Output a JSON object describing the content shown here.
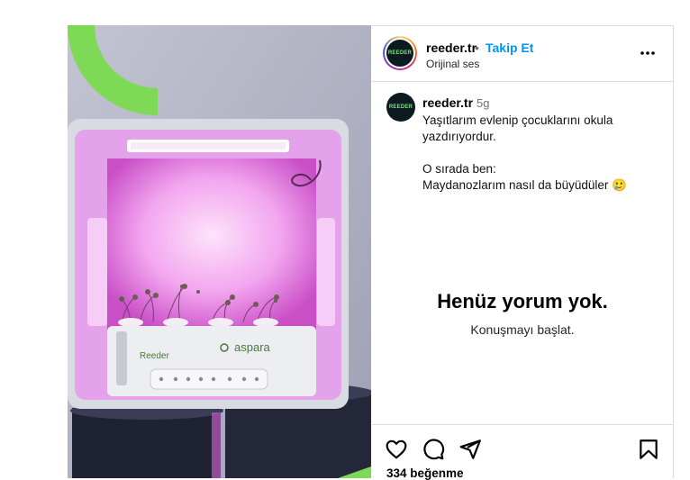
{
  "header": {
    "username": "reeder.tr",
    "separator": "•",
    "follow_label": "Takip Et",
    "audio": "Orijinal ses",
    "avatar_text": "REEDER",
    "more_icon": "more-horizontal-icon"
  },
  "caption": {
    "username": "reeder.tr",
    "time": "5g",
    "lines": [
      "Yaşıtlarım evlenip çocuklarını okula",
      "yazdırıyordur.",
      "",
      "O sırada ben:",
      "Maydanozlarım nasıl da büyüdüler 🥲"
    ]
  },
  "comments": {
    "empty_title": "Henüz yorum yok.",
    "empty_subtitle": "Konuşmayı başlat."
  },
  "actions": {
    "like_icon": "heart-icon",
    "comment_icon": "comment-icon",
    "share_icon": "share-icon",
    "save_icon": "bookmark-icon",
    "likes": "334 beğenme"
  },
  "media": {
    "device_brand": "Reeder",
    "device_logo": "aspara"
  },
  "colors": {
    "accent": "#0095f6",
    "brand_green": "#7ed957",
    "grow_light": "#e89af0"
  }
}
